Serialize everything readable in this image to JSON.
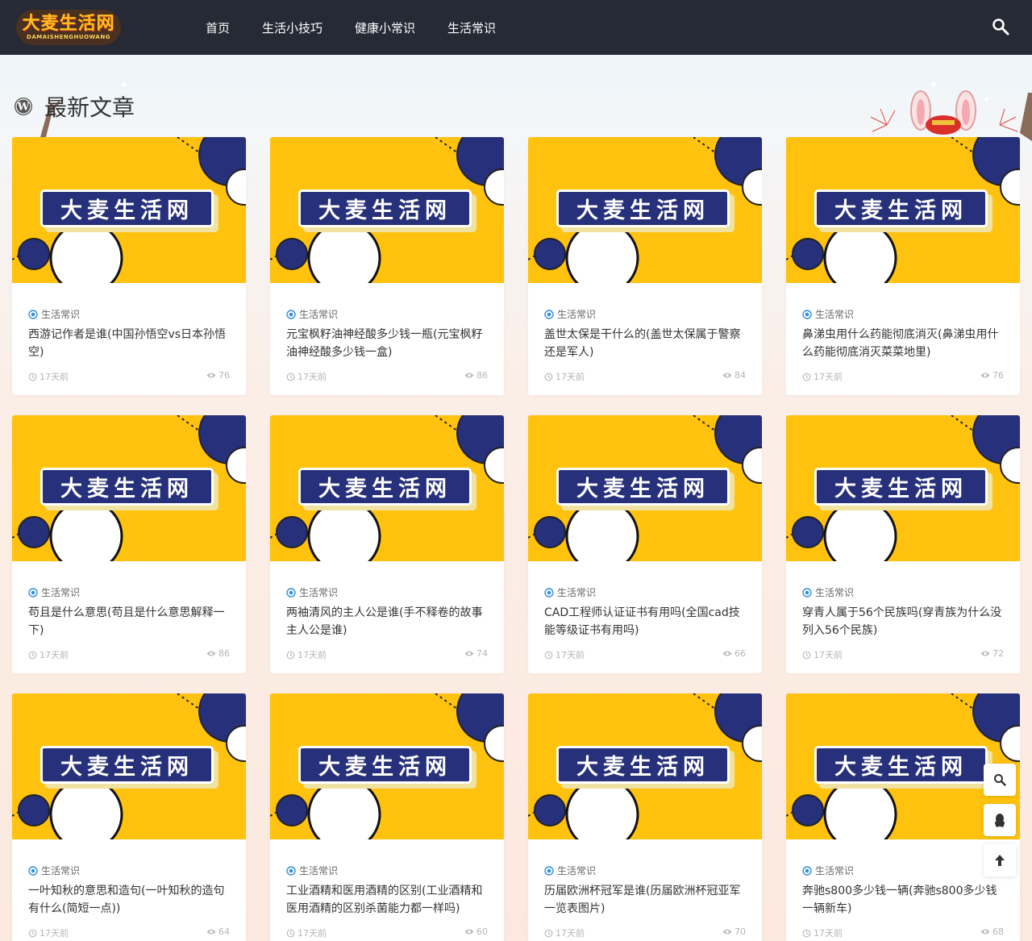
{
  "site": {
    "logo_text": "大麦生活网",
    "logo_sub": "DAMAISHENGHUOWANG"
  },
  "nav": {
    "items": [
      {
        "label": "首页"
      },
      {
        "label": "生活小技巧"
      },
      {
        "label": "健康小常识"
      },
      {
        "label": "生活常识"
      }
    ]
  },
  "section": {
    "title": "最新文章"
  },
  "thumb_label": "大麦生活网",
  "articles": [
    {
      "category": "生活常识",
      "title": "西游记作者是谁(中国孙悟空vs日本孙悟空)",
      "time": "17天前",
      "views": "76"
    },
    {
      "category": "生活常识",
      "title": "元宝枫籽油神经酸多少钱一瓶(元宝枫籽油神经酸多少钱一盒)",
      "time": "17天前",
      "views": "86"
    },
    {
      "category": "生活常识",
      "title": "盖世太保是干什么的(盖世太保属于警察还是军人)",
      "time": "17天前",
      "views": "84"
    },
    {
      "category": "生活常识",
      "title": "鼻涕虫用什么药能彻底消灭(鼻涕虫用什么药能彻底消灭菜菜地里)",
      "time": "17天前",
      "views": "76"
    },
    {
      "category": "生活常识",
      "title": "苟且是什么意思(苟且是什么意思解释一下)",
      "time": "17天前",
      "views": "86"
    },
    {
      "category": "生活常识",
      "title": "两袖清风的主人公是谁(手不释卷的故事主人公是谁)",
      "time": "17天前",
      "views": "74"
    },
    {
      "category": "生活常识",
      "title": "CAD工程师认证证书有用吗(全国cad技能等级证书有用吗)",
      "time": "17天前",
      "views": "66"
    },
    {
      "category": "生活常识",
      "title": "穿青人属于56个民族吗(穿青族为什么没列入56个民族)",
      "time": "17天前",
      "views": "72"
    },
    {
      "category": "生活常识",
      "title": "一叶知秋的意思和造句(一叶知秋的造句有什么(简短一点))",
      "time": "17天前",
      "views": "64"
    },
    {
      "category": "生活常识",
      "title": "工业酒精和医用酒精的区别(工业酒精和医用酒精的区别杀菌能力都一样吗)",
      "time": "17天前",
      "views": "60"
    },
    {
      "category": "生活常识",
      "title": "历届欧洲杯冠军是谁(历届欧洲杯冠亚军一览表图片)",
      "time": "17天前",
      "views": "70"
    },
    {
      "category": "生活常识",
      "title": "奔驰s800多少钱一辆(奔驰s800多少钱一辆新车)",
      "time": "17天前",
      "views": "68"
    }
  ],
  "colors": {
    "header_bg": "#262a35",
    "thumb_yellow": "#ffc20e",
    "thumb_navy": "#27307a",
    "category_blue": "#2f8fe0"
  },
  "icons": {
    "search": "search-icon",
    "wordpress": "wordpress-icon",
    "category": "category-icon",
    "time": "clock-icon",
    "views": "eye-icon",
    "qq": "qq-icon",
    "back_to_top": "arrow-up-icon"
  }
}
